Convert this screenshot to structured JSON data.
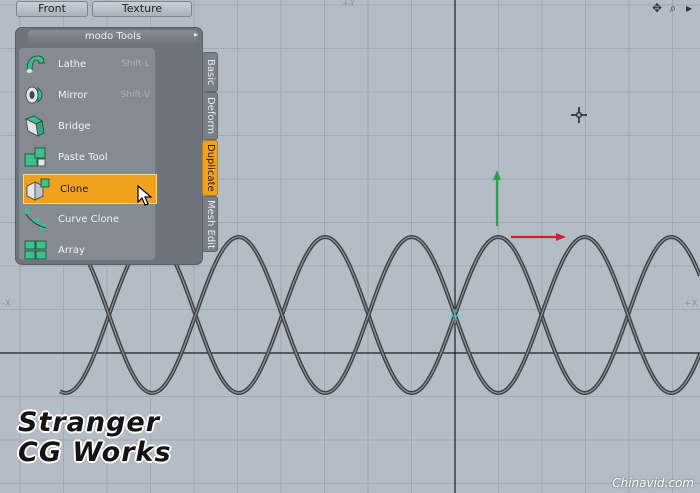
{
  "viewport": {
    "buttons": {
      "front": "Front",
      "texture": "Texture"
    },
    "axis_labels": {
      "top": "+Y",
      "left": "-X",
      "right": "+X"
    },
    "top_icons": [
      "move-view-icon",
      "zoom-view-icon",
      "view-menu-icon"
    ]
  },
  "tools_panel": {
    "title": "modo Tools",
    "items": [
      {
        "label": "Lathe",
        "shortcut": "Shift-L",
        "icon": "lathe-icon"
      },
      {
        "label": "Mirror",
        "shortcut": "Shift-V",
        "icon": "mirror-icon"
      },
      {
        "label": "Bridge",
        "shortcut": "",
        "icon": "bridge-icon"
      },
      {
        "label": "Paste Tool",
        "shortcut": "",
        "icon": "paste-tool-icon"
      },
      {
        "label": "Clone",
        "shortcut": "",
        "icon": "clone-icon",
        "selected": true
      },
      {
        "label": "Curve Clone",
        "shortcut": "",
        "icon": "curve-clone-icon"
      },
      {
        "label": "Array",
        "shortcut": "",
        "icon": "array-icon"
      }
    ],
    "tabs": [
      "Basic",
      "Deform",
      "Duplicate",
      "Mesh Edit"
    ],
    "active_tab": "Duplicate"
  },
  "watermark": {
    "line1": "Stranger",
    "line2": "CG Works"
  },
  "credit": "Chinavid.com",
  "colors": {
    "grid_bg": "#b4bcc6",
    "grid_line": "#a1aab4",
    "axis_line": "#1b1f24",
    "selection": "#f0a21f",
    "y_handle": "#2aa24a",
    "x_handle": "#d0222a",
    "curve": "#3d4146"
  }
}
